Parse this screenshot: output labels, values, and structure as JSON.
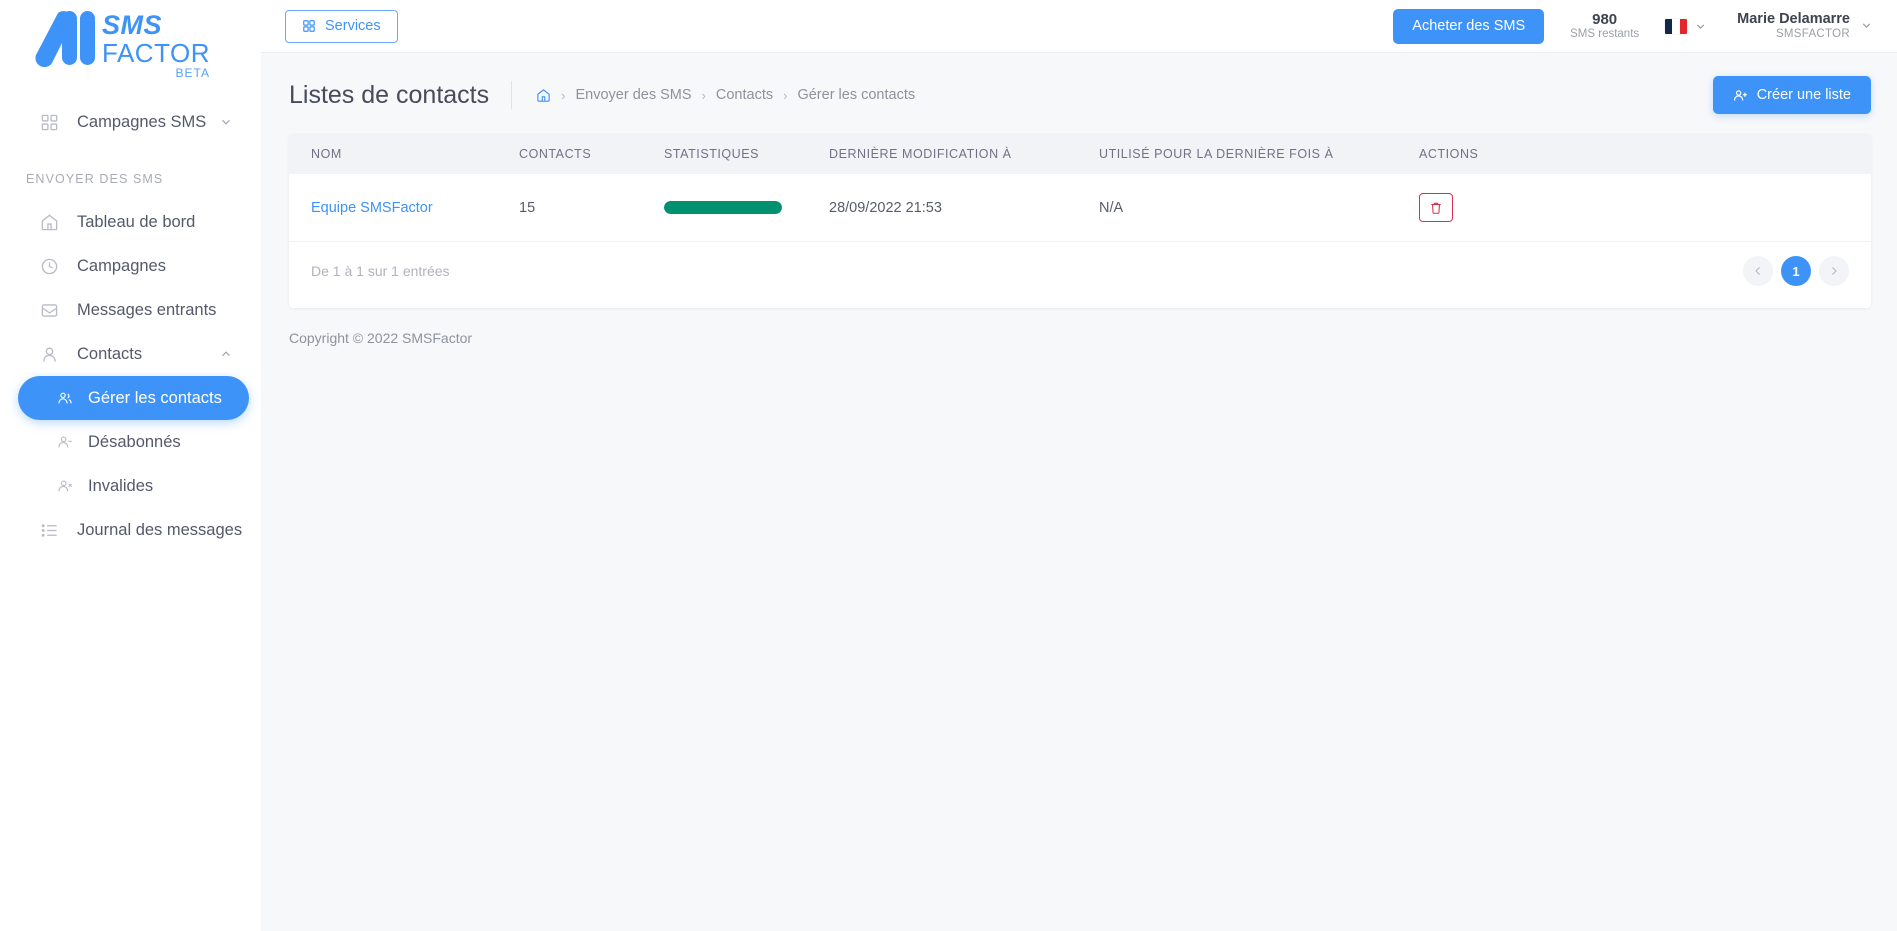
{
  "brand": {
    "name_line1": "SMS",
    "name_line2": "FACTOR",
    "badge": "BETA",
    "accent": "#3d93f7"
  },
  "sidebar": {
    "top_item": {
      "label": "Campagnes SMS",
      "icon": "grid-icon"
    },
    "section_label": "ENVOYER DES SMS",
    "items": [
      {
        "label": "Tableau de bord",
        "icon": "home-icon",
        "active": false
      },
      {
        "label": "Campagnes",
        "icon": "clock-icon",
        "active": false
      },
      {
        "label": "Messages entrants",
        "icon": "inbox-icon",
        "active": false
      },
      {
        "label": "Contacts",
        "icon": "person-icon",
        "active": false,
        "expanded": true
      },
      {
        "label": "Gérer les contacts",
        "icon": "people-group-icon",
        "active": true,
        "sub": true
      },
      {
        "label": "Désabonnés",
        "icon": "person-minus-icon",
        "active": false,
        "sub": true
      },
      {
        "label": "Invalides",
        "icon": "person-x-icon",
        "active": false,
        "sub": true
      },
      {
        "label": "Journal des messages",
        "icon": "list-icon",
        "active": false
      }
    ]
  },
  "topbar": {
    "services_label": "Services",
    "buy_label": "Acheter des SMS",
    "credits_amount": "980",
    "credits_label": "SMS restants",
    "language": "fr",
    "user_name": "Marie Delamarre",
    "user_org": "SMSFACTOR"
  },
  "page": {
    "title": "Listes de contacts",
    "breadcrumb": [
      "Envoyer des SMS",
      "Contacts",
      "Gérer les contacts"
    ],
    "breadcrumb_separator": "›",
    "create_label": "Créer une liste"
  },
  "table": {
    "columns": [
      "NOM",
      "CONTACTS",
      "STATISTIQUES",
      "DERNIÈRE MODIFICATION À",
      "UTILISÉ POUR LA DERNIÈRE FOIS À",
      "ACTIONS"
    ],
    "rows": [
      {
        "name": "Equipe SMSFactor",
        "contacts": "15",
        "stat_percent": 100,
        "stat_color": "#009270",
        "last_modified": "28/09/2022 21:53",
        "last_used": "N/A",
        "action": "delete-icon"
      }
    ],
    "footer_info": "De 1 à 1 sur 1 entrées",
    "pagination": {
      "prev": "‹",
      "pages": [
        "1"
      ],
      "current": "1",
      "next": "›"
    }
  },
  "footer": {
    "copyright": "Copyright © 2022 SMSFactor"
  }
}
